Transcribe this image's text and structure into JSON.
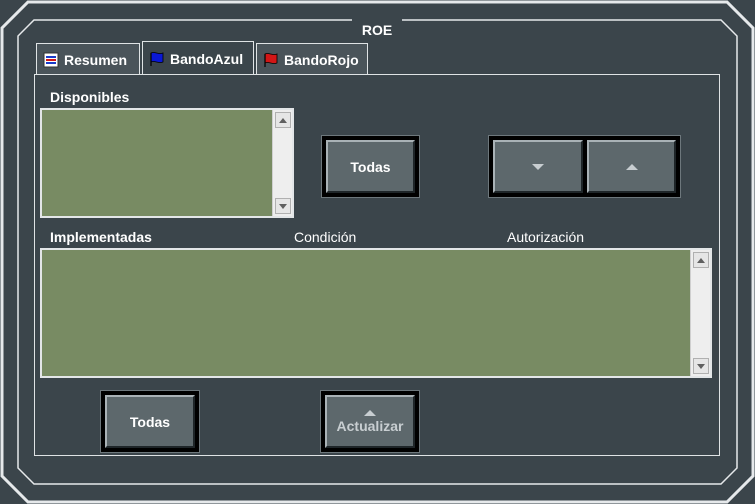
{
  "window": {
    "title": "ROE"
  },
  "tabs": [
    {
      "label": "Resumen",
      "icon": "summary-icon",
      "active": false
    },
    {
      "label": "BandoAzul",
      "icon": "blue-flag-icon",
      "active": true
    },
    {
      "label": "BandoRojo",
      "icon": "red-flag-icon",
      "active": false
    }
  ],
  "available": {
    "label": "Disponibles",
    "all_button": "Todas"
  },
  "implemented": {
    "label": "Implementadas",
    "columns": [
      "Condición",
      "Autorización"
    ],
    "all_button": "Todas",
    "update_button": "Actualizar"
  },
  "colors": {
    "background": "#3b454b",
    "list_fill": "#788b63",
    "button_face": "#5d686c",
    "blue_flag": "#0a18d6",
    "red_flag": "#d21616"
  }
}
